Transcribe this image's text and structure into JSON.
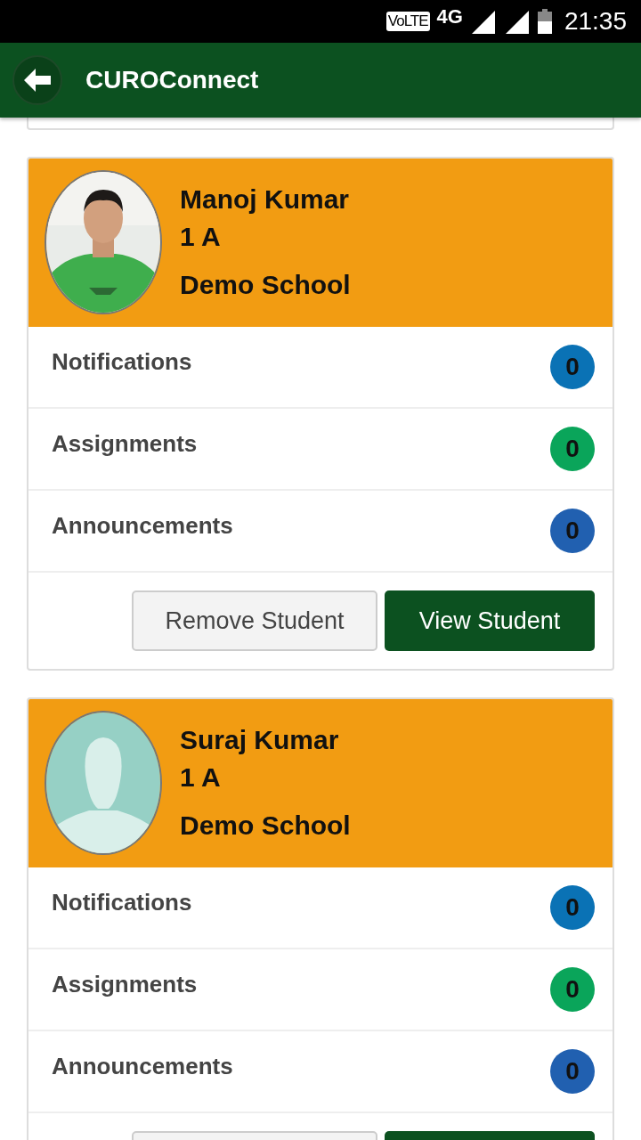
{
  "status_bar": {
    "network": "4G",
    "time": "21:35",
    "volte": "VoLTE"
  },
  "app_bar": {
    "title": "CUROConnect"
  },
  "students": [
    {
      "avatar": {
        "kind": "picture"
      },
      "name": "Manoj Kumar",
      "class": "1 A",
      "school": "Demo School",
      "counters": [
        {
          "label": "Notifications",
          "count": "0",
          "color": "#0a72b5"
        },
        {
          "label": "Assignments",
          "count": "0",
          "color": "#0aa55a"
        },
        {
          "label": "Announcements",
          "count": "0",
          "color": "#2160b0"
        }
      ],
      "buttons": [
        {
          "kind": "secondary",
          "label": "Remove Student"
        },
        {
          "kind": "primary",
          "label": "View Student"
        }
      ]
    },
    {
      "avatar": {
        "kind": "silhouette"
      },
      "name": "Suraj Kumar",
      "class": "1 A",
      "school": "Demo School",
      "counters": [
        {
          "label": "Notifications",
          "count": "0",
          "color": "#0a72b5"
        },
        {
          "label": "Assignments",
          "count": "0",
          "color": "#0aa55a"
        },
        {
          "label": "Announcements",
          "count": "0",
          "color": "#2160b0"
        }
      ],
      "buttons": [
        {
          "kind": "secondary"
        },
        {
          "kind": "primary"
        }
      ]
    }
  ]
}
